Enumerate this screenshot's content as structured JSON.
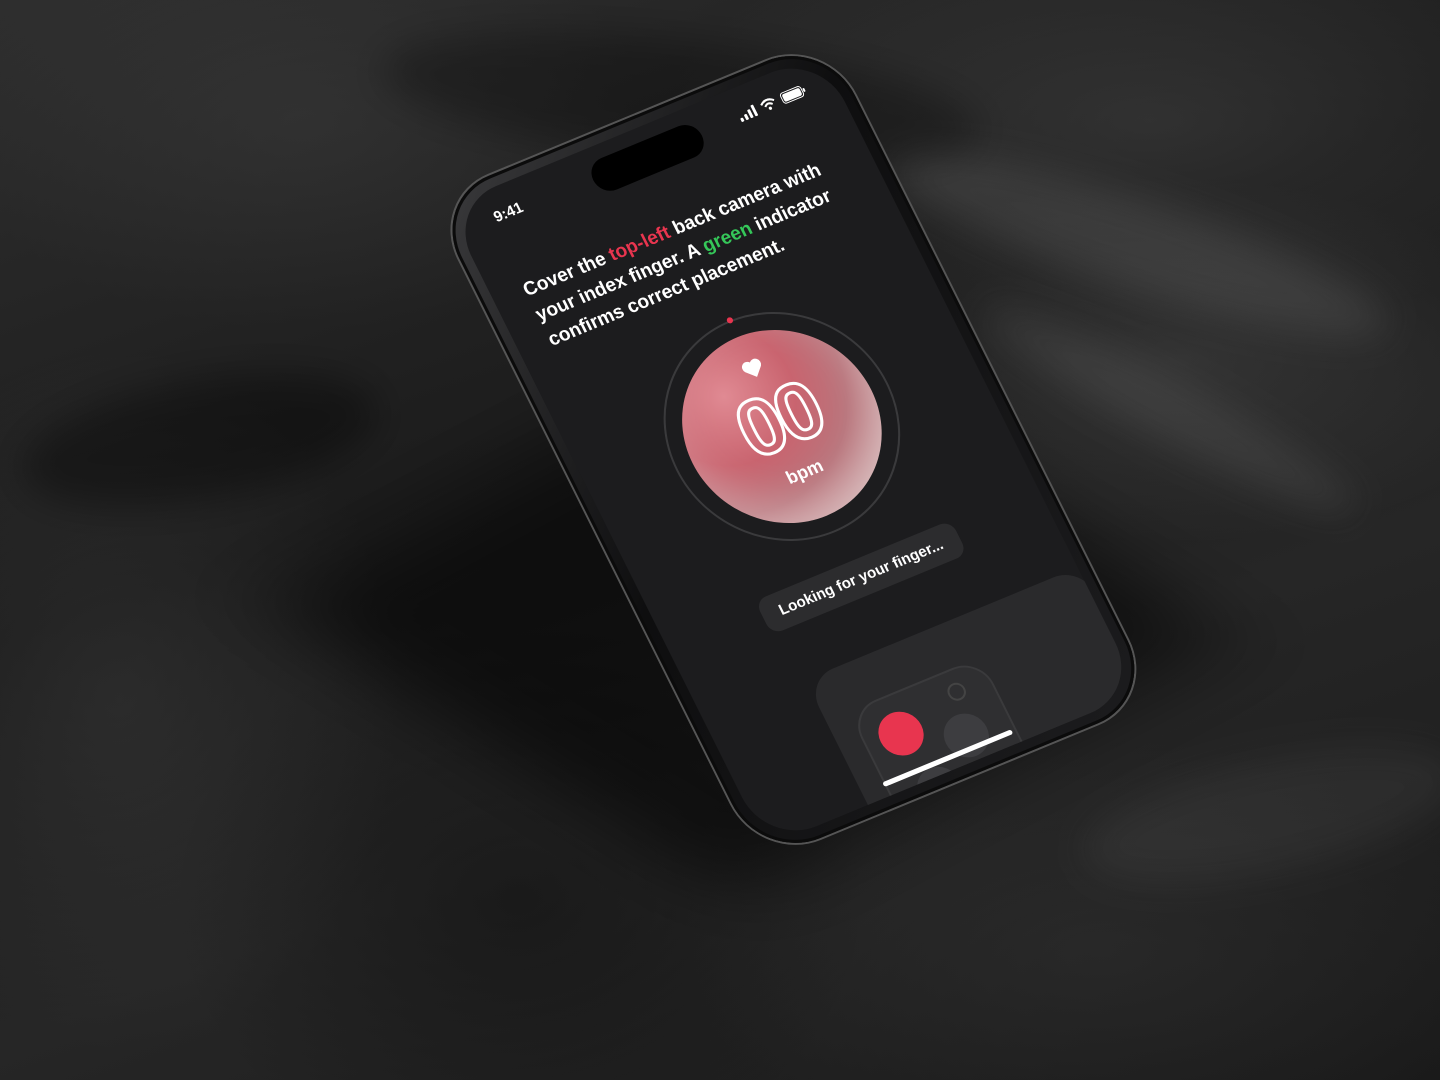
{
  "status_bar": {
    "time": "9:41",
    "icons": [
      "signal-icon",
      "wifi-icon",
      "battery-icon"
    ]
  },
  "instructions": {
    "part1": "Cover the ",
    "highlight_red": "top-left",
    "part2": " back camera with your index finger. A ",
    "highlight_green": "green",
    "part3": " indicator confirms correct placement."
  },
  "measurement": {
    "value": "00",
    "unit": "bpm",
    "icon": "heart-icon"
  },
  "status_message": "Looking for your finger...",
  "camera_guide": {
    "active_lens": "top-left",
    "lenses": [
      "top-left",
      "top-right",
      "bottom-left"
    ]
  },
  "colors": {
    "accent_red": "#e8354f",
    "accent_green": "#35c759",
    "background": "#1c1c1e",
    "card": "#2c2c2e"
  }
}
